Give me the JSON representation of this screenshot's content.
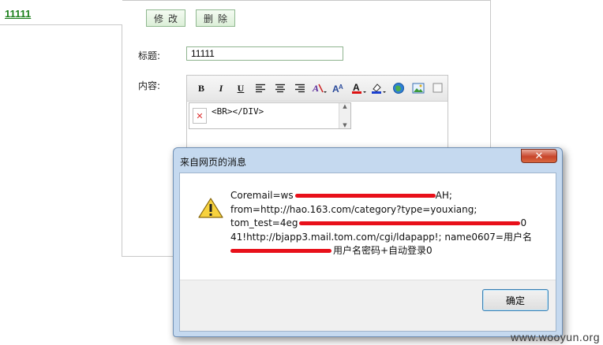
{
  "page": {
    "item_link": "11111",
    "edit_button": "修改",
    "delete_button": "删除",
    "title_label": "标题:",
    "title_value": "11111",
    "content_label": "内容:"
  },
  "editor": {
    "toolbar": [
      {
        "name": "bold-icon",
        "glyph": "B"
      },
      {
        "name": "italic-icon",
        "glyph": "I"
      },
      {
        "name": "underline-icon",
        "glyph": "U"
      },
      {
        "name": "align-left-icon",
        "glyph": ""
      },
      {
        "name": "align-center-icon",
        "glyph": ""
      },
      {
        "name": "align-right-icon",
        "glyph": ""
      },
      {
        "name": "font-style-icon",
        "glyph": ""
      },
      {
        "name": "font-size-icon",
        "glyph": ""
      },
      {
        "name": "font-color-icon",
        "glyph": ""
      },
      {
        "name": "highlight-icon",
        "glyph": ""
      },
      {
        "name": "link-icon",
        "glyph": ""
      },
      {
        "name": "image-icon",
        "glyph": ""
      },
      {
        "name": "html-toggle-icon",
        "glyph": ""
      }
    ],
    "content": "<BR></DIV>"
  },
  "dialog": {
    "title": "来自网页的消息",
    "close_glyph": "✕",
    "lines": [
      "Coremail=ws",
      "AH;",
      "from=http://hao.163.com/category?type=youxiang;",
      "tom_test=4eg",
      "0",
      "41!http://bjapp3.mail.tom.com/cgi/ldapapp!; name0607=用户名",
      "用户名密码+自动登录0"
    ],
    "ok_button": "确定"
  },
  "watermark": "www.wooyun.org",
  "colors": {
    "link_green": "#1a7f1a",
    "dialog_frame": "#c5d9ef",
    "redaction": "#e8101a",
    "close_red": "#c8452b"
  }
}
